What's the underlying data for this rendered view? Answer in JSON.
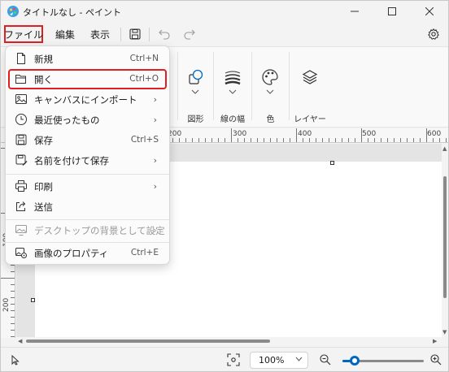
{
  "window": {
    "title": "タイトルなし - ペイント",
    "accent_color": "#0067c0",
    "highlight_color": "#e02020"
  },
  "menubar": {
    "file": "ファイル",
    "edit": "編集",
    "view": "表示"
  },
  "ribbon": {
    "groups": [
      {
        "label": "図形",
        "icon": "shapes-icon"
      },
      {
        "label": "線の幅",
        "icon": "line-width-icon"
      },
      {
        "label": "色",
        "icon": "palette-icon"
      },
      {
        "label": "レイヤー",
        "icon": "layers-icon"
      }
    ]
  },
  "ruler": {
    "top_labels": [
      "200",
      "300",
      "400",
      "500",
      "600"
    ],
    "left_labels": [
      "100",
      "200"
    ]
  },
  "file_menu": {
    "items": [
      {
        "label": "新規",
        "shortcut": "Ctrl+N",
        "icon": "new-file-icon"
      },
      {
        "label": "開く",
        "shortcut": "Ctrl+O",
        "icon": "folder-open-icon",
        "highlighted": true
      },
      {
        "label": "キャンバスにインポート",
        "submenu": true,
        "icon": "import-icon"
      },
      {
        "label": "最近使ったもの",
        "submenu": true,
        "icon": "clock-icon"
      },
      {
        "label": "保存",
        "shortcut": "Ctrl+S",
        "icon": "save-icon"
      },
      {
        "label": "名前を付けて保存",
        "submenu": true,
        "icon": "save-as-icon"
      },
      {
        "label": "印刷",
        "submenu": true,
        "icon": "printer-icon"
      },
      {
        "label": "送信",
        "icon": "share-icon"
      },
      {
        "label": "デスクトップの背景として設定",
        "submenu": true,
        "icon": "desktop-background-icon",
        "disabled": true
      },
      {
        "label": "画像のプロパティ",
        "shortcut": "Ctrl+E",
        "icon": "image-properties-icon"
      }
    ],
    "submenu_arrow": "›"
  },
  "statusbar": {
    "zoom": "100%",
    "zoom_level_fraction": 0.15
  }
}
